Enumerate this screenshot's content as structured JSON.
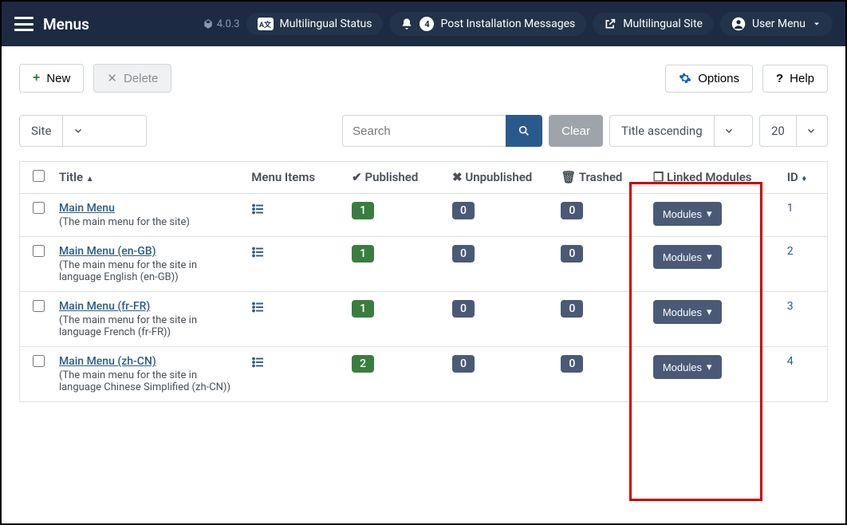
{
  "topbar": {
    "title": "Menus",
    "version": "4.0.3",
    "status_label": "Multilingual Status",
    "notif_count": "4",
    "post_install_label": "Post Installation Messages",
    "site_label": "Multilingual Site",
    "user_menu_label": "User Menu"
  },
  "toolbar": {
    "new_label": "New",
    "delete_label": "Delete",
    "options_label": "Options",
    "help_label": "Help"
  },
  "filters": {
    "client": "Site",
    "search_placeholder": "Search",
    "clear_label": "Clear",
    "sort_label": "Title ascending",
    "limit": "20"
  },
  "columns": {
    "title": "Title",
    "menu_items": "Menu Items",
    "published": "Published",
    "unpublished": "Unpublished",
    "trashed": "Trashed",
    "linked_modules": "Linked Modules",
    "id": "ID"
  },
  "modules_btn_label": "Modules",
  "rows": [
    {
      "title": "Main Menu",
      "desc": "(The main menu for the site)",
      "published": "1",
      "unpublished": "0",
      "trashed": "0",
      "id": "1"
    },
    {
      "title": "Main Menu (en-GB)",
      "desc": "(The main menu for the site in language English (en-GB))",
      "published": "1",
      "unpublished": "0",
      "trashed": "0",
      "id": "2"
    },
    {
      "title": "Main Menu (fr-FR)",
      "desc": "(The main menu for the site in language French (fr-FR))",
      "published": "1",
      "unpublished": "0",
      "trashed": "0",
      "id": "3"
    },
    {
      "title": "Main Menu (zh-CN)",
      "desc": "(The main menu for the site in language Chinese Simplified (zh-CN))",
      "published": "2",
      "unpublished": "0",
      "trashed": "0",
      "id": "4"
    }
  ]
}
